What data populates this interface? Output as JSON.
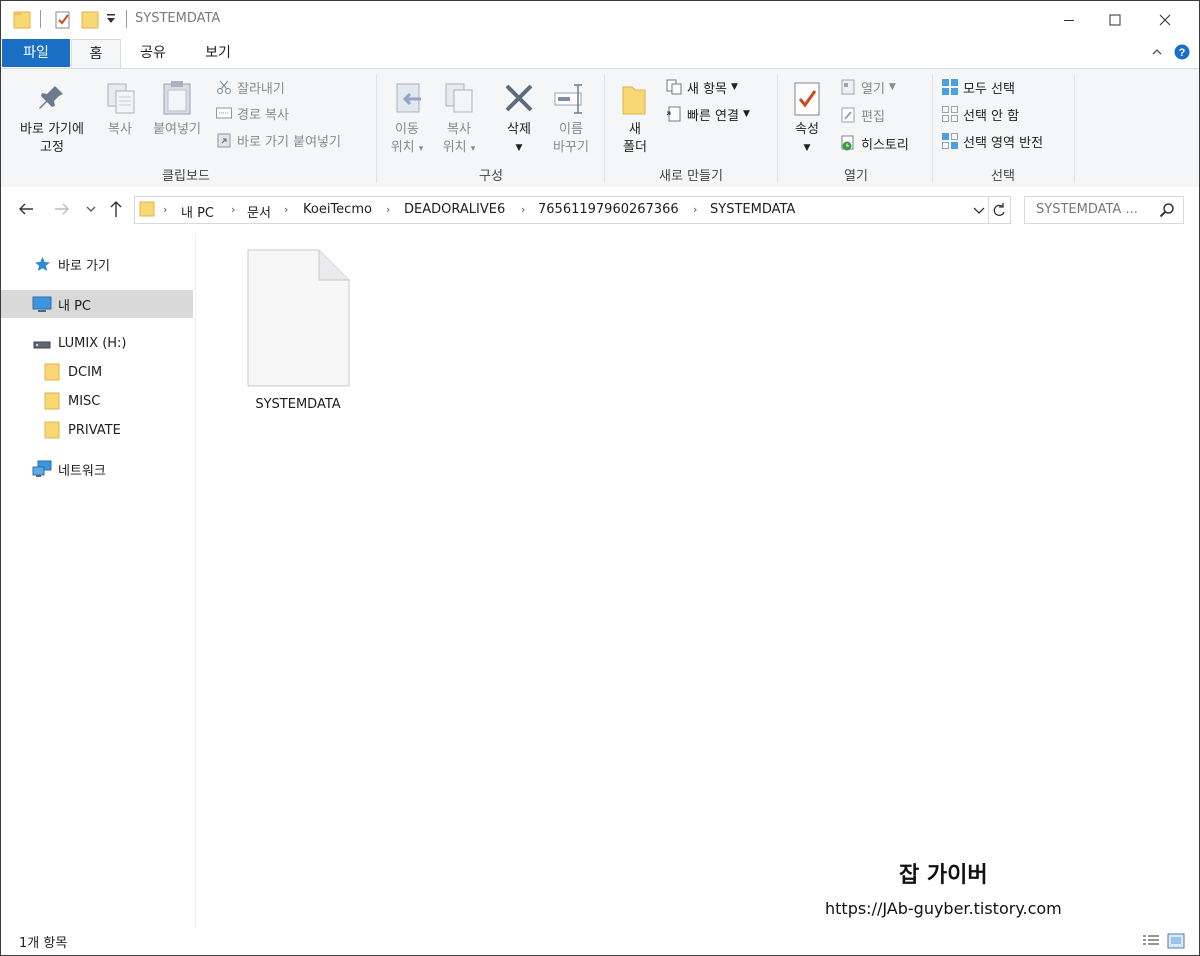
{
  "window": {
    "title": "SYSTEMDATA",
    "controls": [
      "minimize-icon",
      "maximize-icon",
      "close-icon"
    ]
  },
  "ribbon_tabs": [
    {
      "label": "파일",
      "active": false,
      "accent": "#1a6fc4"
    },
    {
      "label": "홈",
      "active": true
    },
    {
      "label": "공유",
      "active": false
    },
    {
      "label": "보기",
      "active": false
    }
  ],
  "ribbon": {
    "clipboard": {
      "group_label": "클립보드",
      "pin_label_1": "바로 가기에",
      "pin_label_2": "고정",
      "copy_label": "복사",
      "paste_label": "붙여넣기",
      "cut_label": "잘라내기",
      "copy_path_label": "경로 복사",
      "paste_shortcut_label": "바로 가기 붙여넣기"
    },
    "organize": {
      "group_label": "구성",
      "move_label_1": "이동",
      "move_label_2": "위치",
      "copyto_label_1": "복사",
      "copyto_label_2": "위치",
      "delete_label": "삭제",
      "rename_label_1": "이름",
      "rename_label_2": "바꾸기"
    },
    "new": {
      "group_label": "새로 만들기",
      "new_folder_label_1": "새",
      "new_folder_label_2": "폴더",
      "new_item_label": "새 항목",
      "easy_access_label": "빠른 연결"
    },
    "open": {
      "group_label": "열기",
      "properties_label": "속성",
      "open_label": "열기",
      "edit_label": "편집",
      "history_label": "히스토리"
    },
    "select": {
      "group_label": "선택",
      "select_all_label": "모두 선택",
      "select_none_label": "선택 안 함",
      "invert_label": "선택 영역 반전"
    }
  },
  "address": {
    "breadcrumbs": [
      "내 PC",
      "문서",
      "KoeiTecmo",
      "DEADORALIVE6",
      "76561197960267366",
      "SYSTEMDATA"
    ],
    "search_placeholder": "SYSTEMDATA ..."
  },
  "nav": {
    "items": [
      {
        "label": "바로 가기",
        "icon": "star-icon",
        "selected": false
      },
      {
        "label": "내 PC",
        "icon": "computer-icon",
        "selected": true
      },
      {
        "label": "LUMIX (H:)",
        "icon": "drive-icon",
        "selected": false
      },
      {
        "label": "DCIM",
        "icon": "folder-icon",
        "selected": false
      },
      {
        "label": "MISC",
        "icon": "folder-icon",
        "selected": false
      },
      {
        "label": "PRIVATE",
        "icon": "folder-icon",
        "selected": false
      },
      {
        "label": "네트워크",
        "icon": "network-icon",
        "selected": false
      }
    ]
  },
  "files": [
    {
      "name": "SYSTEMDATA",
      "icon": "file-icon"
    }
  ],
  "status": {
    "count": "1개 항목"
  },
  "watermark": {
    "title": "잡 가이버",
    "url": "https://JAb-guyber.tistory.com"
  }
}
